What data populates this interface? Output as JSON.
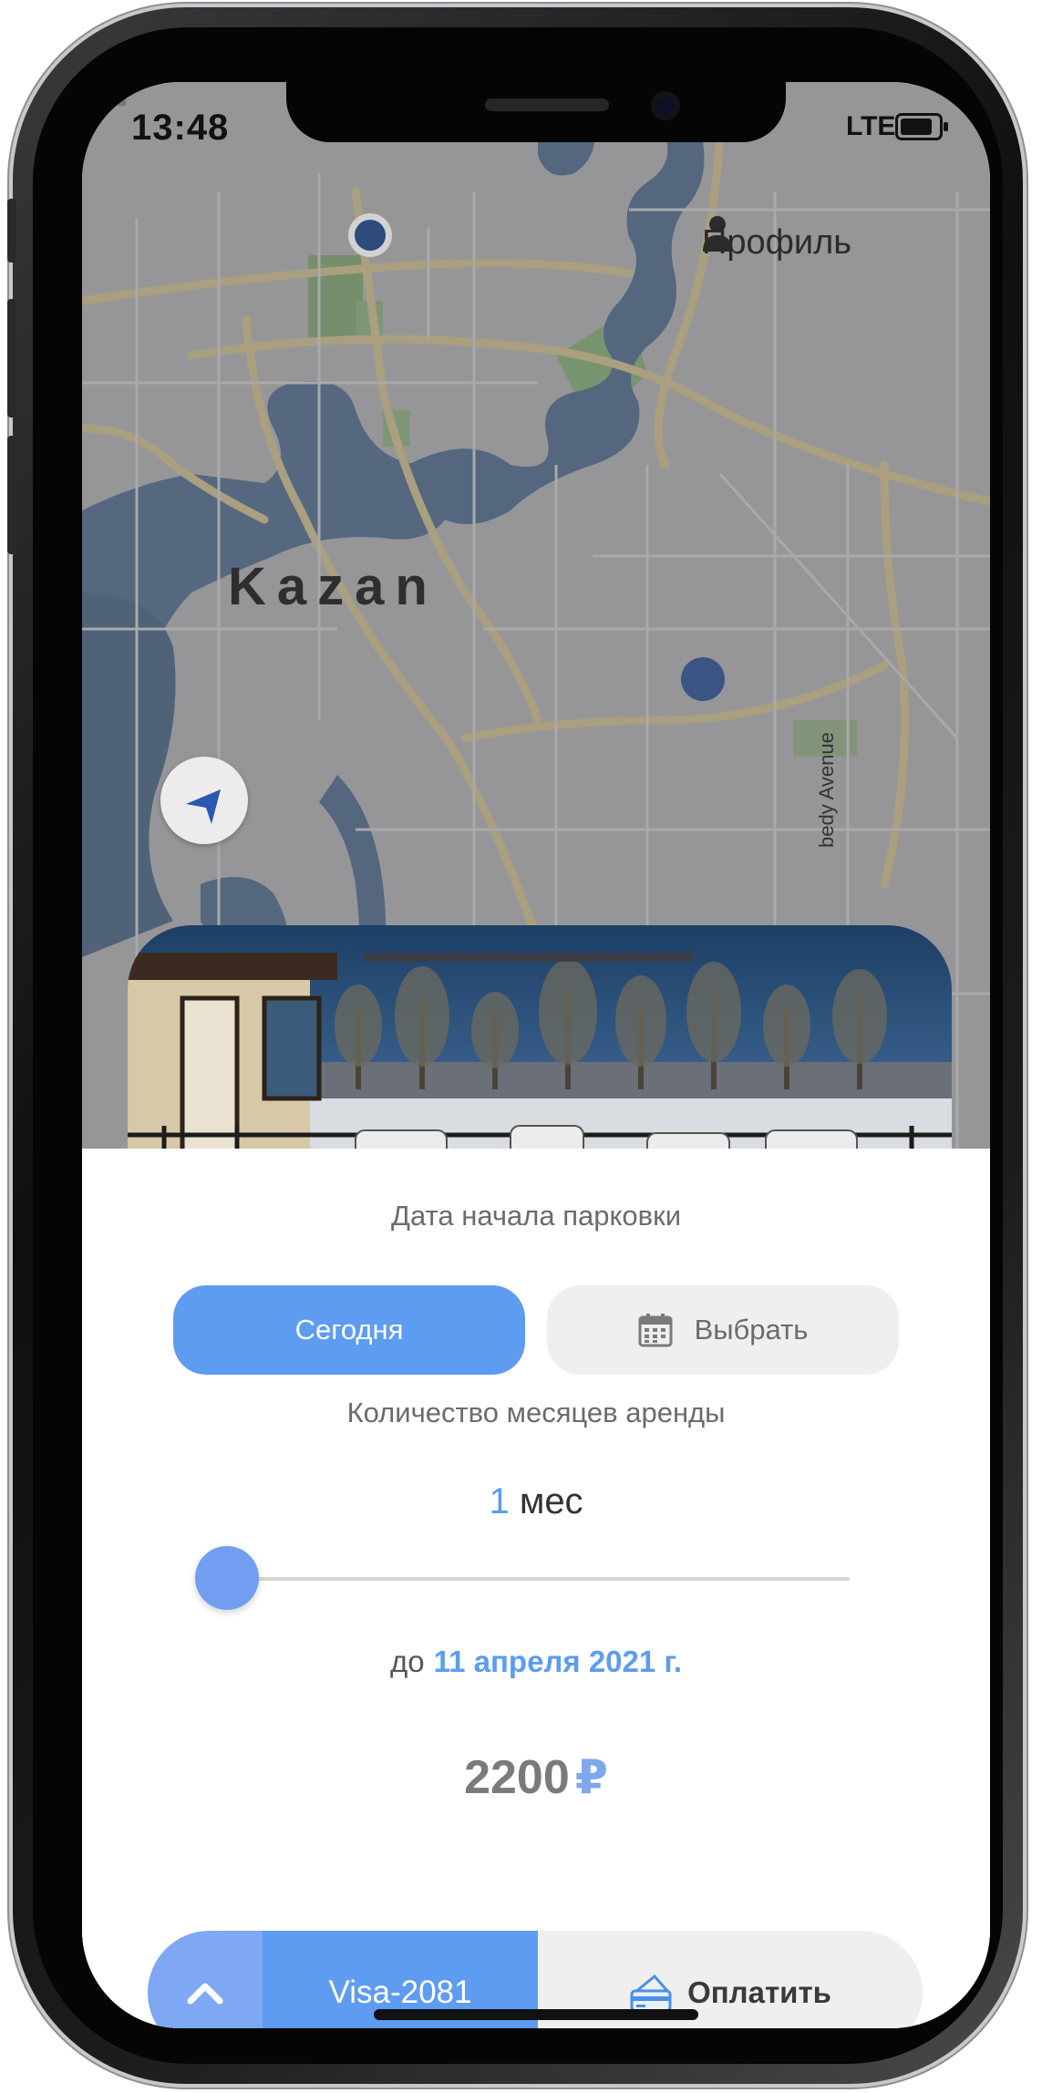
{
  "status_bar": {
    "time": "13:48",
    "network": "LTE"
  },
  "map": {
    "profile_label": "Профиль",
    "city_label": "Kazan",
    "street_label": "bedy Avenue"
  },
  "booking": {
    "start_date_label": "Дата начала парковки",
    "today_button": "Сегодня",
    "pick_button": "Выбрать",
    "months_label": "Количество месяцев аренды",
    "months_value": "1",
    "months_unit": "мес",
    "slider_value_fraction": 0.0,
    "until_prefix": "до",
    "until_date": "11 апреля 2021 г.",
    "price": "2200",
    "currency": "₽"
  },
  "payment": {
    "card_name": "Visa-2081",
    "pay_button": "Оплатить"
  },
  "colors": {
    "accent": "#5d9cf0",
    "accent_light": "#7ea7f4",
    "button_gray": "#efefef"
  }
}
